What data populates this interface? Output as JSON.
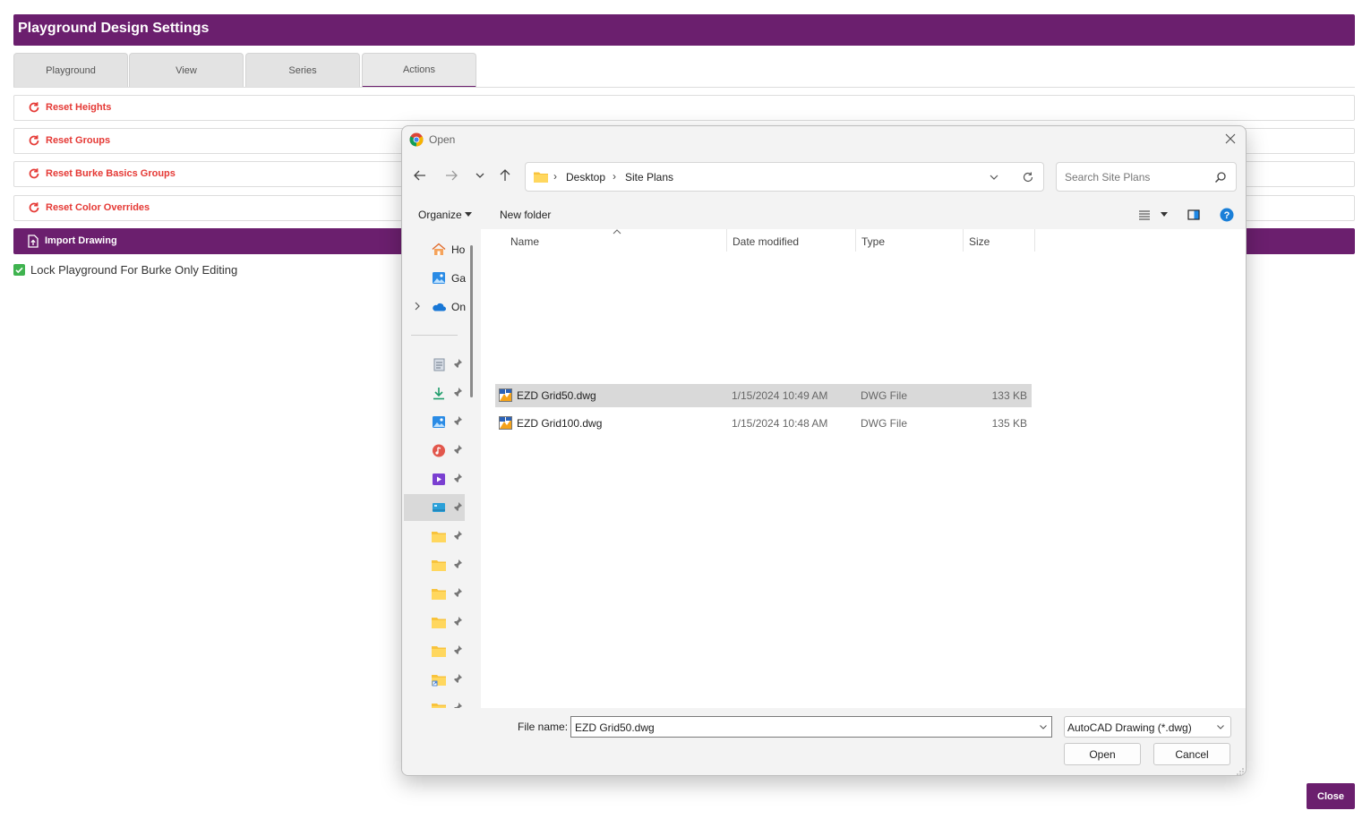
{
  "app": {
    "title": "Playground Design Settings",
    "tabs": [
      {
        "label": "Playground",
        "active": false
      },
      {
        "label": "View",
        "active": false
      },
      {
        "label": "Series",
        "active": false
      },
      {
        "label": "Actions",
        "active": true
      }
    ],
    "actions": [
      {
        "label": "Reset Heights",
        "icon": "refresh-icon"
      },
      {
        "label": "Reset Groups",
        "icon": "refresh-icon"
      },
      {
        "label": "Reset Burke Basics Groups",
        "icon": "refresh-icon"
      },
      {
        "label": "Reset Color Overrides",
        "icon": "refresh-icon"
      }
    ],
    "import": {
      "label": "Import Drawing",
      "icon": "file-upload-icon"
    },
    "lock": {
      "label": "Lock Playground For Burke Only Editing",
      "checked": true
    },
    "close_label": "Close",
    "colors": {
      "brand": "#6b1f6e",
      "action_text": "#e53935",
      "check": "#3fb34f"
    }
  },
  "dialog": {
    "title": "Open",
    "breadcrumb": [
      "Desktop",
      "Site Plans"
    ],
    "search_placeholder": "Search Site Plans",
    "organize_label": "Organize",
    "new_folder_label": "New folder",
    "nav": [
      {
        "label": "Ho",
        "icon": "home-icon"
      },
      {
        "label": "Ga",
        "icon": "gallery-icon"
      },
      {
        "label": "On",
        "icon": "onedrive-icon"
      }
    ],
    "quick_access_icons": [
      "documents-icon",
      "downloads-icon",
      "pictures-icon",
      "music-icon",
      "videos-icon",
      "desktop-icon",
      "folder-icon",
      "folder-icon",
      "folder-icon",
      "folder-icon",
      "folder-icon",
      "folder-shortcut-icon",
      "folder-icon"
    ],
    "columns": {
      "name": "Name",
      "date": "Date modified",
      "type": "Type",
      "size": "Size"
    },
    "files": [
      {
        "name": "EZD Grid50.dwg",
        "date": "1/15/2024 10:49 AM",
        "type": "DWG File",
        "size": "133 KB",
        "selected": true
      },
      {
        "name": "EZD Grid100.dwg",
        "date": "1/15/2024 10:48 AM",
        "type": "DWG File",
        "size": "135 KB",
        "selected": false
      }
    ],
    "file_name_label": "File name:",
    "file_name_value": "EZD Grid50.dwg",
    "file_type_value": "AutoCAD Drawing (*.dwg)",
    "open_label": "Open",
    "cancel_label": "Cancel"
  }
}
